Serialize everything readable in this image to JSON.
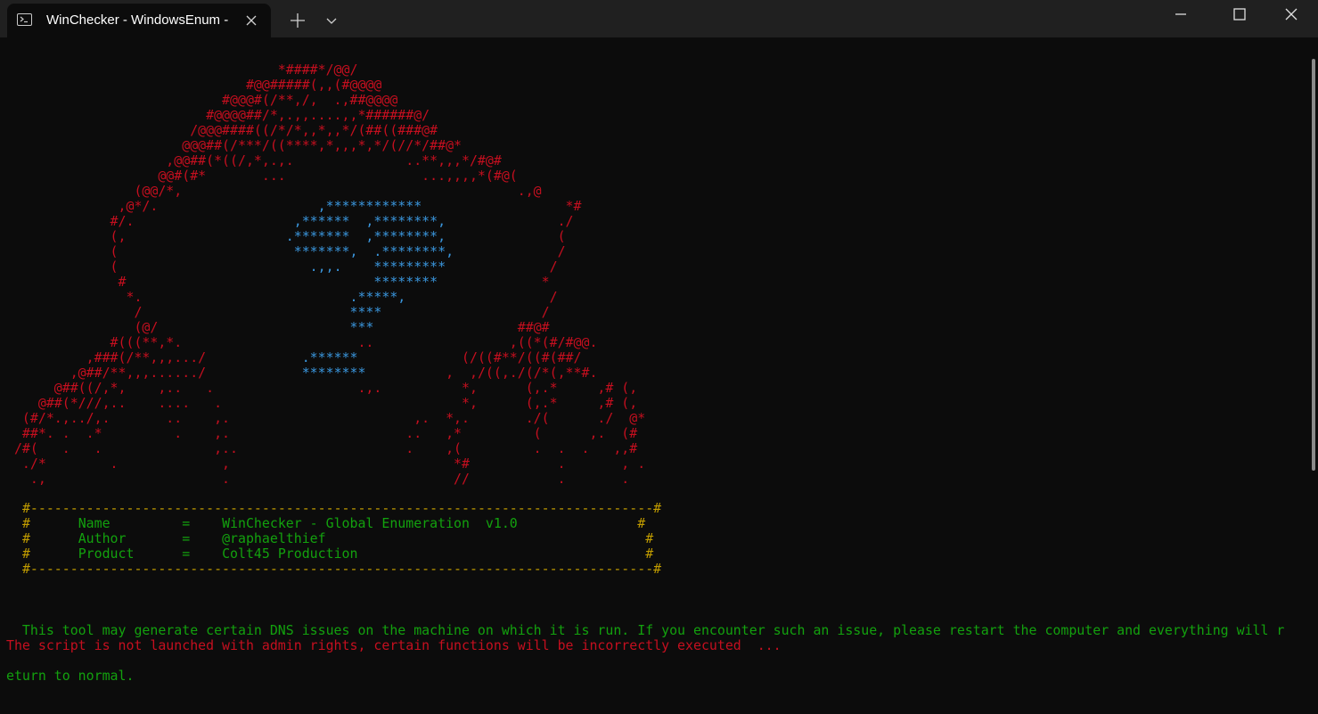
{
  "window": {
    "tab_title": "WinChecker - WindowsEnum -",
    "tab_icon": "terminal-icon",
    "controls": [
      "new-tab-icon",
      "chevron-down-icon",
      "minimize-icon",
      "maximize-icon",
      "close-icon"
    ]
  },
  "terminal": {
    "background": "#0c0c0c",
    "colors": {
      "red": "#c50f1f",
      "blue": "#3a96dd",
      "yellow": "#c19c00",
      "green": "#13a10e"
    },
    "art_lines": [
      [
        "                                  *####*/@@/"
      ],
      [
        "                              #@@#####(,,(#@@@@"
      ],
      [
        "                           #@@@#(/**,/,  .,##@@@@"
      ],
      [
        "                         #@@@@##/*,.,,....,,*######@/"
      ],
      [
        "                       /@@@####((/*/*,,*,,*/(##((###@#"
      ],
      [
        "                      @@@##(/***/((****,*,,,*,*/(//*/##@*"
      ],
      [
        "                    ,@@##(*((/,*,.,.              ..**,,,*/#@#"
      ],
      [
        "                   @@#(#*       ...                 ...,,,,*(#@("
      ],
      [
        "                (@@/*,                                          .,@"
      ],
      [
        "              ,@*/.       ",
        "             ,************",
        "                  *#"
      ],
      [
        "             #/.         ",
        "           ,******  ,********,",
        "              ./"
      ],
      [
        "             (,         ",
        "           .*******  ,********,",
        "              ("
      ],
      [
        "             (          ",
        "            *******,  .********,",
        "             /"
      ],
      [
        "             (          ",
        "              .,,.    *********",
        "             /"
      ],
      [
        "              #          ",
        "                     ********",
        "             *"
      ],
      [
        "               *.       ",
        "                   .*****,",
        "                  /"
      ],
      [
        "                /       ",
        "                   ****",
        "                    /"
      ],
      [
        "                (@/     ",
        "                   ***",
        "                  ##@#"
      ],
      [
        "             #(((**,*.                      ..                 ,((*(#/#@@."
      ],
      [
        "          ,###(/**,,,.../     ",
        "       .******",
        "             (/((#**/((#(##/"
      ],
      [
        "        ,@##/**,,,....../     ",
        "       ********",
        "          ,  ,/((,./(/*(,**#."
      ],
      [
        "      @##((/,*,    ,..   .                  .,.          *,      (,.*     ,# (,"
      ],
      [
        "    @##(*///,..    ....   .                              *,      (,.*     ,# (,"
      ],
      [
        "  (#/*.,../,.       ..    ,.                       ,.  *,.       ./(      ./  @*"
      ],
      [
        "  ##*. .  .*         .    ,.                      ..   ,*         (      ,.  (#"
      ],
      [
        " /#(   .   .              ,..                     .    ,(         .  .  .   ,,#"
      ],
      [
        "  ./*        .             ,                            *#           .       , ."
      ],
      [
        "   .,                      .                            //           .       ."
      ]
    ],
    "banner": [
      [
        "#------------------------------------------------------------------------------#"
      ],
      [
        "#",
        "      Name         =    WinChecker - Global Enumeration  v1.0               ",
        "#"
      ],
      [
        "#",
        "      Author       =    @raphaelthief                                        ",
        "#"
      ],
      [
        "#",
        "      Product      =    Colt45 Production                                    ",
        "#"
      ],
      [
        "#------------------------------------------------------------------------------#"
      ]
    ],
    "notice_line1": "  This tool may generate certain DNS issues on the machine on which it is run. If you encounter such an issue, please restart the computer and everything will r",
    "notice_line2": "eturn to normal.",
    "warning": "The script is not launched with admin rights, certain functions will be incorrectly executed  ..."
  }
}
